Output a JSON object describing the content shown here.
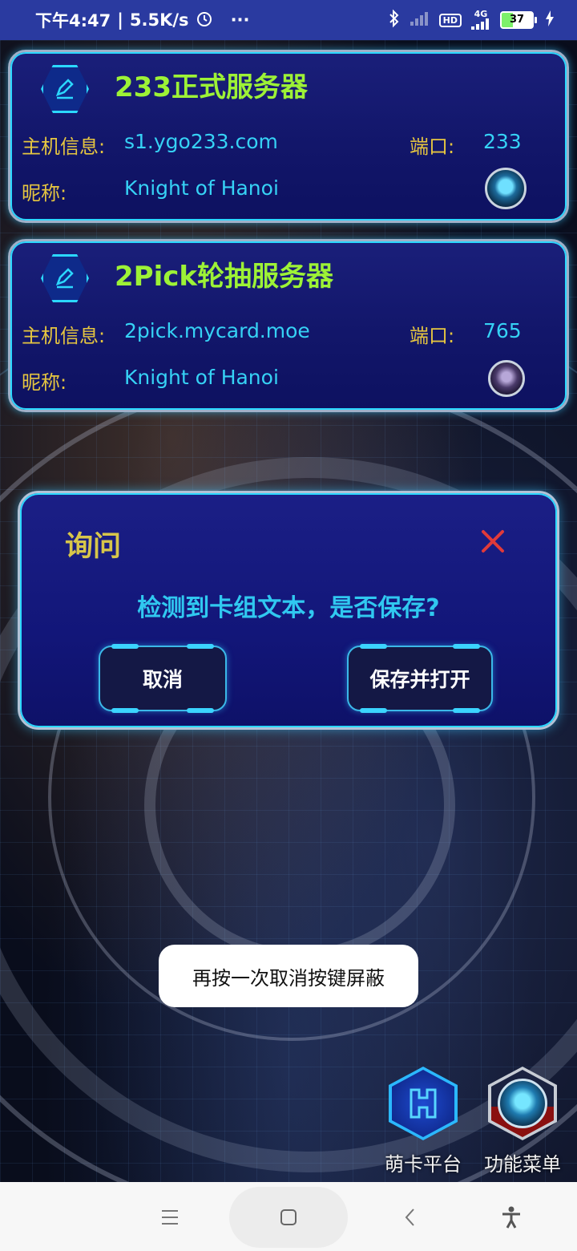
{
  "status_bar": {
    "time": "下午4:47",
    "network_speed": "5.5K/s",
    "more": "···",
    "hd": "HD",
    "signal": "4G",
    "battery": "37"
  },
  "servers": [
    {
      "title": "233正式服务器",
      "host_label": "主机信息:",
      "host": "s1.ygo233.com",
      "port_label": "端口:",
      "port": "233",
      "nick_label": "昵称:",
      "nickname": "Knight of Hanoi"
    },
    {
      "title": "2Pick轮抽服务器",
      "host_label": "主机信息:",
      "host": "2pick.mycard.moe",
      "port_label": "端口:",
      "port": "765",
      "nick_label": "昵称:",
      "nickname": "Knight of Hanoi"
    }
  ],
  "dialog": {
    "title": "询问",
    "message": "检测到卡组文本，是否保存?",
    "cancel": "取消",
    "confirm": "保存并打开"
  },
  "toast": "再按一次取消按键屏蔽",
  "bottom_buttons": {
    "mycard": "萌卡平台",
    "menu": "功能菜单"
  },
  "colors": {
    "title_green": "#9df236",
    "label_gold": "#e6c640",
    "value_cyan": "#36d2f5",
    "close_red": "#e03a3a"
  }
}
